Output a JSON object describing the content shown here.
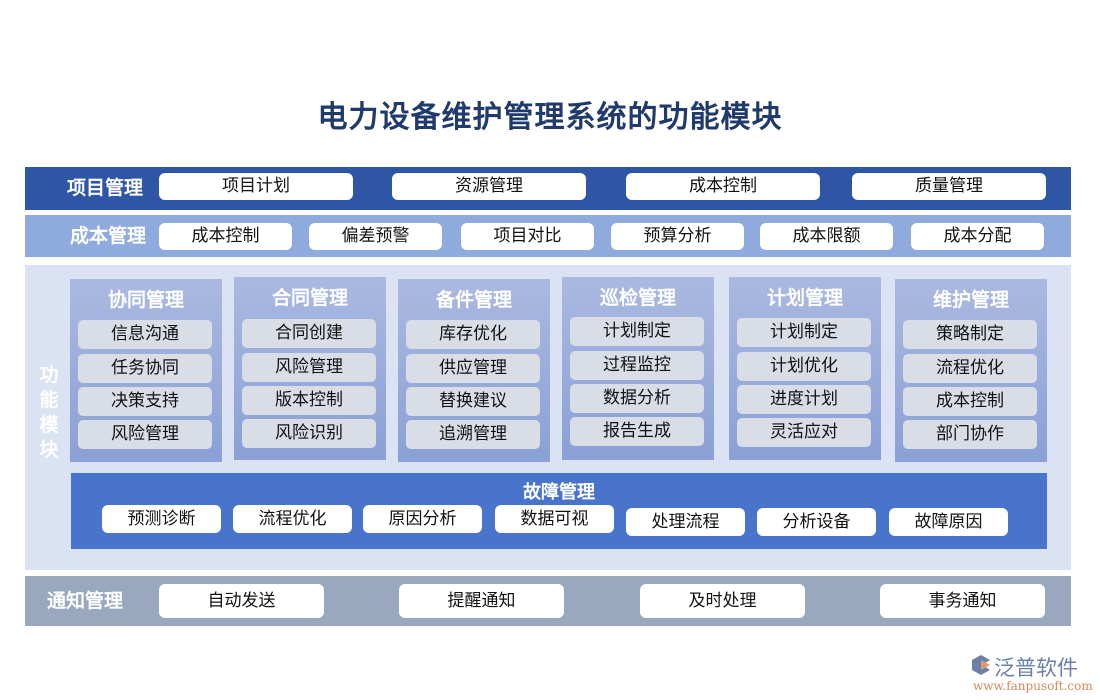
{
  "title": "电力设备维护管理系统的功能模块",
  "project_mgmt": {
    "label": "项目管理",
    "items": [
      "项目计划",
      "资源管理",
      "成本控制",
      "质量管理"
    ]
  },
  "cost_mgmt": {
    "label": "成本管理",
    "items": [
      "成本控制",
      "偏差预警",
      "项目对比",
      "预算分析",
      "成本限额",
      "成本分配"
    ]
  },
  "function_modules": {
    "label": "功能模块",
    "label_chars": [
      "功",
      "能",
      "模",
      "块"
    ],
    "modules": [
      {
        "title": "协同管理",
        "items": [
          "信息沟通",
          "任务协同",
          "决策支持",
          "风险管理"
        ]
      },
      {
        "title": "合同管理",
        "items": [
          "合同创建",
          "风险管理",
          "版本控制",
          "风险识别"
        ]
      },
      {
        "title": "备件管理",
        "items": [
          "库存优化",
          "供应管理",
          "替换建议",
          "追溯管理"
        ]
      },
      {
        "title": "巡检管理",
        "items": [
          "计划制定",
          "过程监控",
          "数据分析",
          "报告生成"
        ]
      },
      {
        "title": "计划管理",
        "items": [
          "计划制定",
          "计划优化",
          "进度计划",
          "灵活应对"
        ]
      },
      {
        "title": "维护管理",
        "items": [
          "策略制定",
          "流程优化",
          "成本控制",
          "部门协作"
        ]
      }
    ],
    "fault": {
      "title": "故障管理",
      "items": [
        "预测诊断",
        "流程优化",
        "原因分析",
        "数据可视",
        "处理流程",
        "分析设备",
        "故障原因"
      ]
    }
  },
  "notify_mgmt": {
    "label": "通知管理",
    "items": [
      "自动发送",
      "提醒通知",
      "及时处理",
      "事务通知"
    ]
  },
  "logo": {
    "name": "泛普软件",
    "url": "www.fanpusoft.com"
  },
  "colors": {
    "title": "#1f3a6b",
    "project_bar": "#2f55a5",
    "cost_bar": "#8faadc",
    "function_bg": "#dae2f3",
    "fault_bar": "#4874cc",
    "notify_bar": "#99a8bf"
  }
}
